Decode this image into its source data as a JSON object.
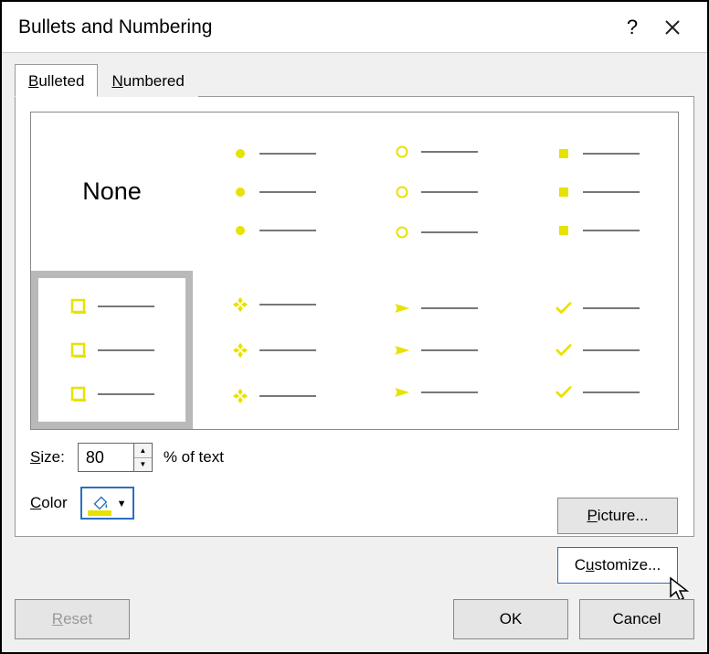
{
  "dialog": {
    "title": "Bullets and Numbering",
    "help_tooltip": "?",
    "close_tooltip": "Close"
  },
  "tabs": {
    "bulleted": "Bulleted",
    "numbered": "Numbered",
    "active": "bulleted"
  },
  "grid": {
    "none_label": "None",
    "selected_index": 4,
    "options": [
      {
        "id": "none",
        "kind": "none"
      },
      {
        "id": "filled-circle",
        "kind": "filled-circle"
      },
      {
        "id": "hollow-circle",
        "kind": "hollow-circle"
      },
      {
        "id": "filled-square",
        "kind": "filled-square"
      },
      {
        "id": "hollow-square",
        "kind": "hollow-square"
      },
      {
        "id": "four-diamonds",
        "kind": "four-diamonds"
      },
      {
        "id": "arrowhead",
        "kind": "arrowhead"
      },
      {
        "id": "checkmark",
        "kind": "checkmark"
      }
    ]
  },
  "size": {
    "label": "Size:",
    "value": "80",
    "suffix": "% of text"
  },
  "color": {
    "label": "Color",
    "value": "#e8e200"
  },
  "buttons": {
    "picture": "Picture...",
    "customize": "Customize...",
    "reset": "Reset",
    "ok": "OK",
    "cancel": "Cancel"
  }
}
